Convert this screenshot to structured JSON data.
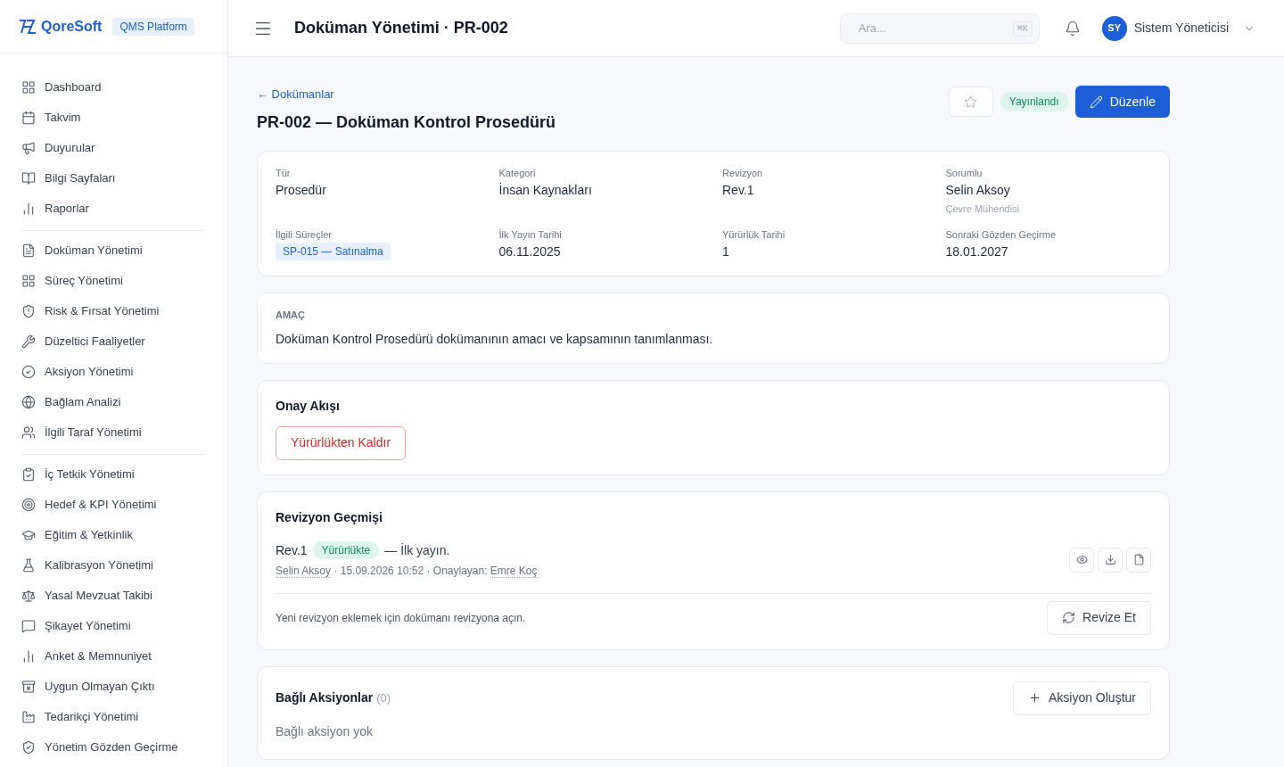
{
  "brand": {
    "name": "QoreSoft",
    "badge": "QMS Platform"
  },
  "header": {
    "title": "Doküman Yönetimi · PR-002",
    "search": {
      "placeholder": "Ara...",
      "shortcut": "⌘K"
    },
    "user": {
      "initials": "SY",
      "name": "Sistem Yöneticisi"
    }
  },
  "sidebar": {
    "groups": [
      {
        "items": [
          {
            "label": "Dashboard"
          },
          {
            "label": "Takvim"
          },
          {
            "label": "Duyurular"
          },
          {
            "label": "Bilgi Sayfaları"
          },
          {
            "label": "Raporlar"
          }
        ]
      },
      {
        "items": [
          {
            "label": "Doküman Yönetimi"
          },
          {
            "label": "Süreç Yönetimi"
          },
          {
            "label": "Risk & Fırsat Yönetimi"
          },
          {
            "label": "Düzeltici Faaliyetler"
          },
          {
            "label": "Aksiyon Yönetimi"
          },
          {
            "label": "Bağlam Analizi"
          },
          {
            "label": "İlgili Taraf Yönetimi"
          }
        ]
      },
      {
        "items": [
          {
            "label": "İç Tetkik Yönetimi"
          },
          {
            "label": "Hedef & KPI Yönetimi"
          },
          {
            "label": "Eğitim & Yetkinlik"
          },
          {
            "label": "Kalibrasyon Yönetimi"
          },
          {
            "label": "Yasal Mevzuat Takibi"
          },
          {
            "label": "Şikayet Yönetimi"
          },
          {
            "label": "Anket & Memnuniyet"
          },
          {
            "label": "Uygun Olmayan Çıktı"
          },
          {
            "label": "Tedarikçi Yönetimi"
          },
          {
            "label": "Yönetim Gözden Geçirme"
          }
        ]
      }
    ]
  },
  "page": {
    "back_link": "← Dokümanlar",
    "title": "PR-002 — Doküman Kontrol Prosedürü",
    "favorite": false,
    "status": "Yayınlandı",
    "edit_button": "Düzenle"
  },
  "details": [
    {
      "label": "Tür",
      "value": "Prosedür"
    },
    {
      "label": "Kategori",
      "value": "İnsan Kaynakları"
    },
    {
      "label": "Revizyon",
      "value": "Rev.1"
    },
    {
      "label": "Sorumlu",
      "value": "Selin Aksoy",
      "sub": "Çevre Mühendisi"
    },
    {
      "label": "İlgili Süreçler",
      "tag": "SP-015 — Satınalma"
    },
    {
      "label": "İlk Yayın Tarihi",
      "value": "06.11.2025"
    },
    {
      "label": "Yürürlük Tarihi",
      "value": "1"
    },
    {
      "label": "Sonraki Gözden Geçirme",
      "value": "18.01.2027"
    }
  ],
  "purpose": {
    "label": "AMAÇ",
    "text": "Doküman Kontrol Prosedürü dokümanının amacı ve kapsamının tanımlanması."
  },
  "approval": {
    "title": "Onay Akışı",
    "button": "Yürürlükten Kaldır"
  },
  "revisions": {
    "title": "Revizyon Geçmişi",
    "items": [
      {
        "rev": "Rev.1",
        "status": "Yürürlükte",
        "note": "— İlk yayın.",
        "author": "Selin Aksoy",
        "date": " · 15.09.2026 10:52 · Onaylayan: ",
        "approver": "Emre Koç"
      }
    ],
    "hint": "Yeni revizyon eklemek için dokümanı revizyona açın.",
    "button": "Revize Et"
  },
  "actions": {
    "title": "Bağlı Aksiyonlar",
    "count": "(0)",
    "button": "Aksiyon Oluştur",
    "empty": "Bağlı aksiyon yok"
  }
}
